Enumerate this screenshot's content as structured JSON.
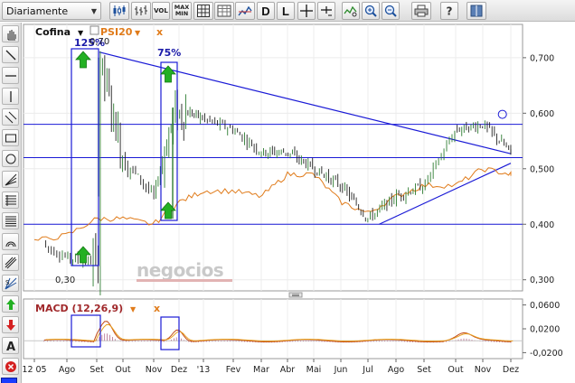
{
  "toolbar": {
    "period_select": "Diariamente",
    "vol_label": "VOL",
    "maxmin_label_1": "MAX",
    "maxmin_label_2": "MIN",
    "d_label": "D",
    "l_label": "L"
  },
  "chart": {
    "instrument": "Cofina",
    "compare": "PSI20",
    "compare_remove": "x",
    "watermark": "negocios",
    "price_ticks": [
      "0,700",
      "0,600",
      "0,500",
      "0,400",
      "0,300"
    ],
    "macd_label": "MACD (12,26,9)",
    "macd_ticks": [
      "0,0600",
      "0,0200",
      "-0,0200"
    ],
    "x_labels": [
      "12 05",
      "Ago",
      "Set",
      "Out",
      "Nov",
      "Dez",
      "'13",
      "Fev",
      "Mar",
      "Abr",
      "Mai",
      "Jun",
      "Jul",
      "Ago",
      "Set",
      "Out",
      "Nov",
      "Dez"
    ],
    "annotations": {
      "gain_1": "125%",
      "gain_2": "75%",
      "high_label": "0,70",
      "low_label": "0,30"
    },
    "colors": {
      "price_up": "#2e7d32",
      "price_down": "#222222",
      "psi20": "#e07b1a",
      "trend": "#1a1ad6",
      "arrow": "#23b023"
    }
  },
  "chart_data": {
    "type": "line",
    "title": "",
    "series": [
      {
        "name": "Cofina",
        "x": [
          "12 05",
          "Ago",
          "Set",
          "Set",
          "Out",
          "Nov",
          "Dez",
          "'13",
          "Fev",
          "Mar",
          "Abr",
          "Mai",
          "Jun",
          "Jul",
          "Ago",
          "Set",
          "Out",
          "Nov",
          "Dez"
        ],
        "values": [
          0.37,
          0.34,
          0.33,
          0.7,
          0.52,
          0.45,
          0.6,
          0.6,
          0.57,
          0.53,
          0.53,
          0.5,
          0.47,
          0.41,
          0.45,
          0.47,
          0.57,
          0.58,
          0.53
        ]
      },
      {
        "name": "PSI20",
        "x": [
          "12 05",
          "Ago",
          "Set",
          "Out",
          "Nov",
          "Dez",
          "'13",
          "Fev",
          "Mar",
          "Abr",
          "Mai",
          "Jun",
          "Jul",
          "Ago",
          "Set",
          "Out",
          "Nov",
          "Dez"
        ],
        "values": [
          0.37,
          0.38,
          0.41,
          0.41,
          0.4,
          0.44,
          0.46,
          0.46,
          0.45,
          0.49,
          0.49,
          0.44,
          0.42,
          0.45,
          0.47,
          0.47,
          0.5,
          0.49
        ]
      }
    ],
    "horizontal_levels": [
      0.58,
      0.52,
      0.4
    ],
    "ylim": [
      0.28,
      0.76
    ],
    "macd": {
      "name": "MACD (12,26,9)",
      "ylim": [
        -0.03,
        0.07
      ]
    }
  }
}
